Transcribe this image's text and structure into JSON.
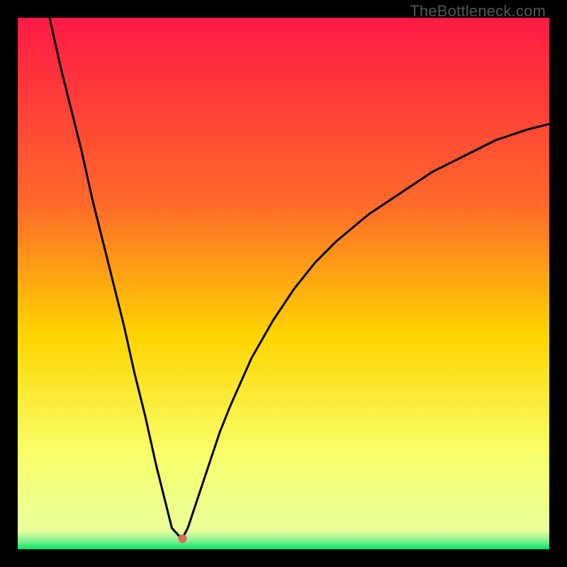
{
  "watermark": "TheBottleneck.com",
  "colors": {
    "gradient_top": "#ff1a45",
    "gradient_mid1": "#ff6a2a",
    "gradient_mid2": "#ffd500",
    "gradient_low": "#f8ff6a",
    "gradient_bottom": "#00e561",
    "curve": "#000000",
    "marker": "#d86a5a",
    "frame": "#000000"
  },
  "chart_data": {
    "type": "line",
    "title": "",
    "xlabel": "",
    "ylabel": "",
    "xlim": [
      0,
      100
    ],
    "ylim": [
      0,
      100
    ],
    "series": [
      {
        "name": "bottleneck-curve",
        "x": [
          6,
          8,
          10,
          12,
          14,
          16,
          18,
          20,
          22,
          24,
          26,
          27,
          28,
          29,
          29.5,
          29.8,
          30,
          30.2,
          30.5,
          31,
          32,
          34,
          36,
          38,
          40,
          44,
          48,
          52,
          56,
          60,
          66,
          72,
          78,
          84,
          90,
          96,
          100
        ],
        "y": [
          100,
          91,
          83,
          75,
          66,
          58,
          50,
          42,
          33,
          25,
          16,
          12,
          8,
          4,
          2.5,
          2.2,
          2.0,
          2.0,
          2.0,
          2.1,
          4,
          10,
          16,
          22,
          27,
          36,
          43,
          49,
          54,
          58,
          63,
          67,
          71,
          74,
          77,
          79,
          80
        ]
      }
    ],
    "flat_segment": {
      "x0": 29.0,
      "x1": 30.8,
      "y": 2.0
    },
    "marker": {
      "x": 31,
      "y": 2,
      "r": 6
    },
    "gradient_stops": [
      {
        "offset": 0.0,
        "color": "#ff1a45"
      },
      {
        "offset": 0.35,
        "color": "#ff6a2a"
      },
      {
        "offset": 0.6,
        "color": "#ffd500"
      },
      {
        "offset": 0.82,
        "color": "#f8ff6a"
      },
      {
        "offset": 0.965,
        "color": "#eaff9a"
      },
      {
        "offset": 0.985,
        "color": "#7df091"
      },
      {
        "offset": 1.0,
        "color": "#00e561"
      }
    ]
  }
}
